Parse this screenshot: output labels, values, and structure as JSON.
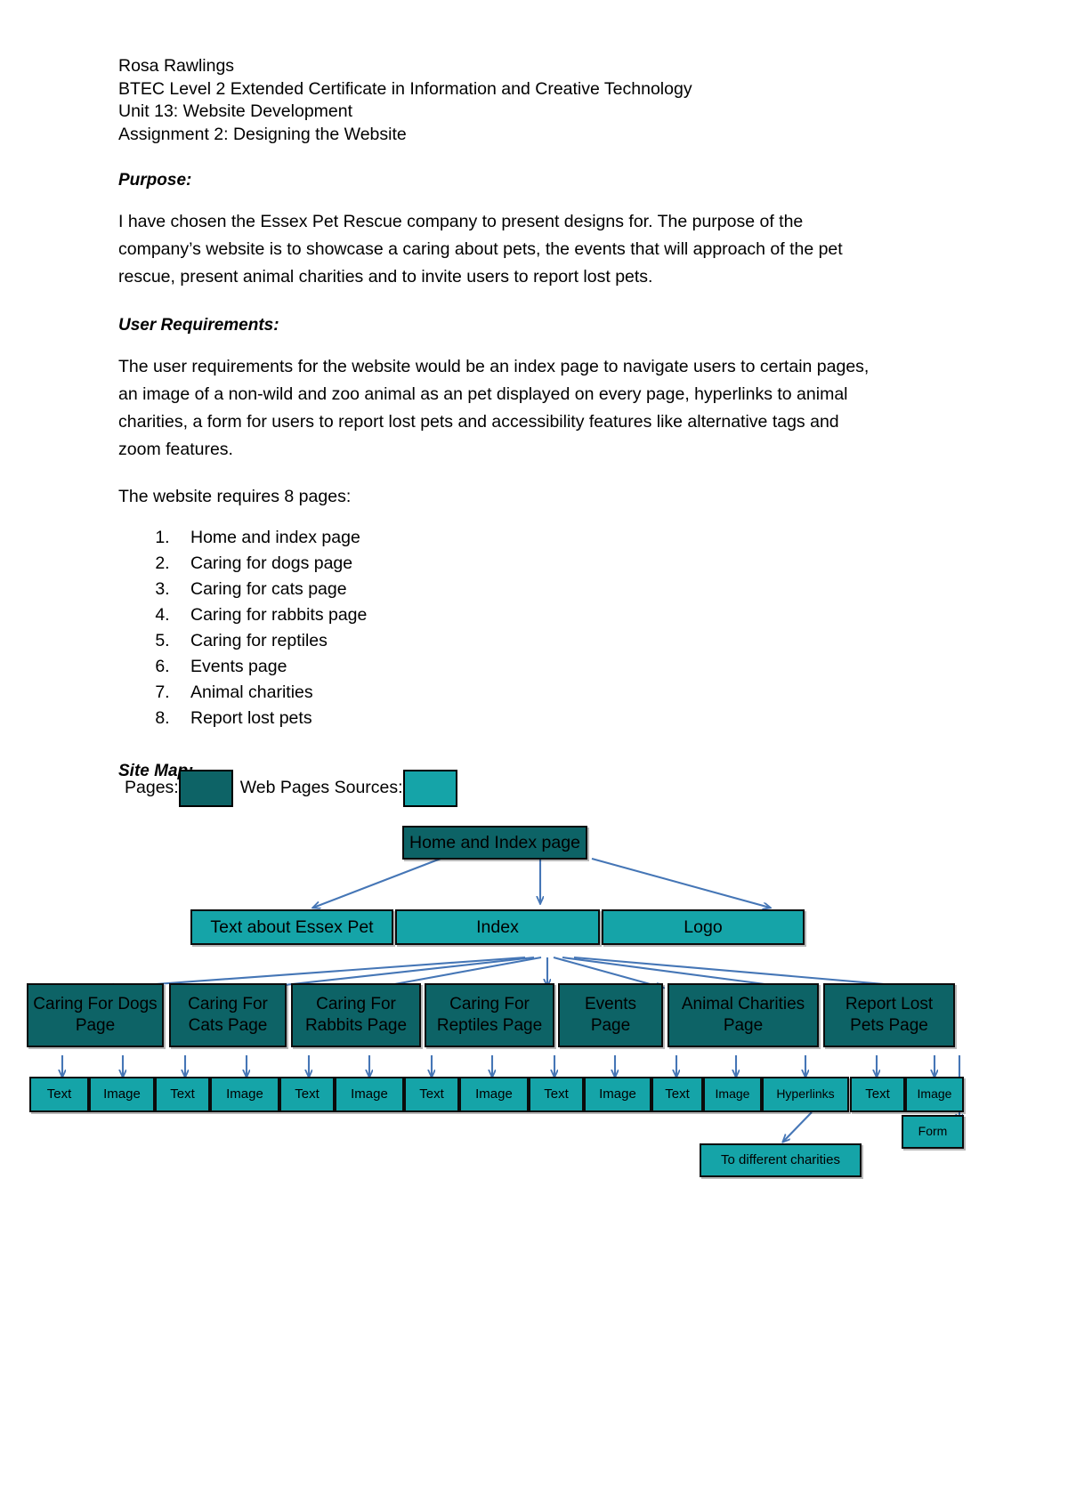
{
  "header": {
    "lines": [
      "Rosa Rawlings",
      "BTEC Level 2 Extended Certificate in Information and Creative Technology",
      "Unit 13: Website Development",
      "Assignment 2: Designing the Website"
    ]
  },
  "sections": {
    "purpose": {
      "heading": "Purpose:",
      "body": "I have chosen the Essex Pet Rescue company to present designs for. The purpose of the company’s website is to showcase a caring about pets, the events that will approach of the pet rescue, present animal charities and to invite users to report lost pets."
    },
    "user_requirements": {
      "heading": "User Requirements:",
      "body": "The user requirements for the website would be an index page to navigate users to certain pages, an image of a non-wild and zoo animal as an pet displayed on every page, hyperlinks to animal charities, a form for users to report lost pets and accessibility features like alternative tags and zoom features."
    },
    "pages_intro": "The website requires 8 pages:",
    "pages_list": [
      "Home and index page",
      "Caring for dogs page",
      "Caring for cats page",
      "Caring for rabbits page",
      "Caring for reptiles",
      "Events page",
      "Animal charities",
      "Report lost pets"
    ],
    "site_map": {
      "heading": "Site Map:",
      "legend": {
        "pages_label": "Pages:",
        "pages_color": "#0d6366",
        "sources_label": "Web Pages Sources:",
        "sources_color": "#15a4a8"
      },
      "nodes": {
        "root": "Home and Index page",
        "level2": [
          "Text about Essex Pet",
          "Index",
          "Logo"
        ],
        "level3": [
          "Caring For Dogs Page",
          "Caring For Cats Page",
          "Caring For Rabbits Page",
          "Caring For Reptiles Page",
          "Events Page",
          "Animal Charities Page",
          "Report Lost Pets Page"
        ],
        "leaves": [
          "Text",
          "Image",
          "Text",
          "Image",
          "Text",
          "Image",
          "Text",
          "Image",
          "Text",
          "Image",
          "Text",
          "Image",
          "Hyperlinks",
          "Text",
          "Image"
        ],
        "extra": [
          "To different charities",
          "Form"
        ]
      }
    }
  }
}
